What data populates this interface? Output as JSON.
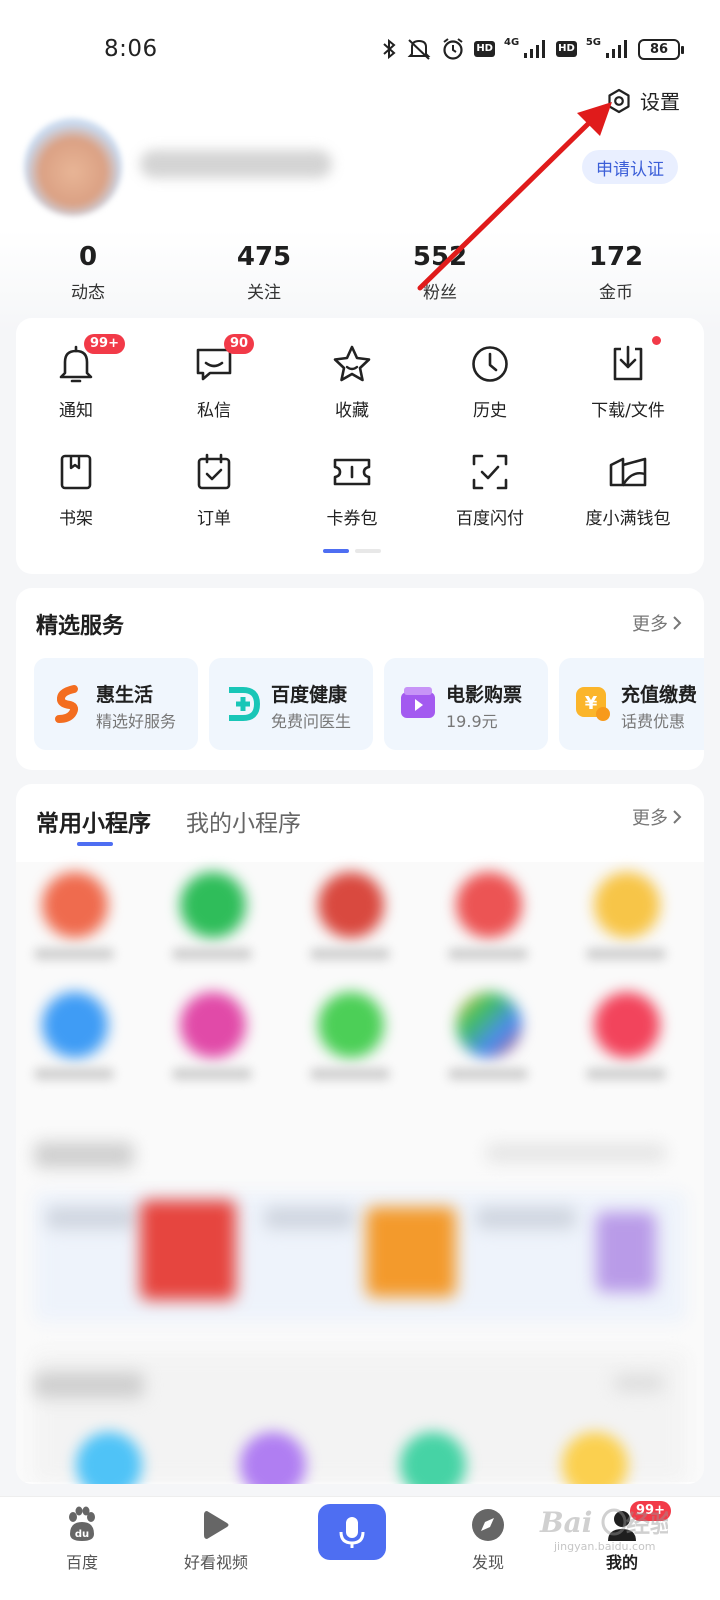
{
  "status_bar": {
    "time": "8:06",
    "net1": "4G",
    "net2": "5G",
    "hd": "HD",
    "battery": "86"
  },
  "header": {
    "settings_label": "设置",
    "certify_label": "申请认证"
  },
  "stats": [
    {
      "value": "0",
      "label": "动态"
    },
    {
      "value": "475",
      "label": "关注"
    },
    {
      "value": "552",
      "label": "粉丝"
    },
    {
      "value": "172",
      "label": "金币"
    }
  ],
  "tools": [
    {
      "label": "通知",
      "icon": "bell-icon",
      "badge": "99+"
    },
    {
      "label": "私信",
      "icon": "message-icon",
      "badge": "90"
    },
    {
      "label": "收藏",
      "icon": "star-icon"
    },
    {
      "label": "历史",
      "icon": "clock-icon"
    },
    {
      "label": "下载/文件",
      "icon": "download-icon",
      "dot": true
    },
    {
      "label": "书架",
      "icon": "bookshelf-icon"
    },
    {
      "label": "订单",
      "icon": "order-icon"
    },
    {
      "label": "卡券包",
      "icon": "coupon-icon"
    },
    {
      "label": "百度闪付",
      "icon": "scan-pay-icon"
    },
    {
      "label": "度小满钱包",
      "icon": "wallet-icon"
    }
  ],
  "services": {
    "title": "精选服务",
    "more": "更多",
    "items": [
      {
        "name": "惠生活",
        "desc": "精选好服务",
        "icon": "hui-life-icon"
      },
      {
        "name": "百度健康",
        "desc": "免费问医生",
        "icon": "health-icon"
      },
      {
        "name": "电影购票",
        "desc": "19.9元",
        "icon": "movie-ticket-icon"
      },
      {
        "name": "充值缴费",
        "desc": "话费优惠",
        "icon": "recharge-icon"
      }
    ]
  },
  "mini_programs": {
    "tab_common": "常用小程序",
    "tab_mine": "我的小程序",
    "more": "更多"
  },
  "bottom_nav": {
    "items": [
      {
        "label": "百度",
        "icon": "baidu-paw-icon"
      },
      {
        "label": "好看视频",
        "icon": "play-icon"
      },
      {
        "label": "发现",
        "icon": "compass-icon"
      },
      {
        "label": "我的",
        "icon": "profile-icon",
        "badge": "99+"
      }
    ],
    "voice_icon": "microphone-icon"
  },
  "colors": {
    "accent": "#4e6ef2",
    "badge_red": "#f23a48",
    "arrow_red": "#e01b1b"
  }
}
